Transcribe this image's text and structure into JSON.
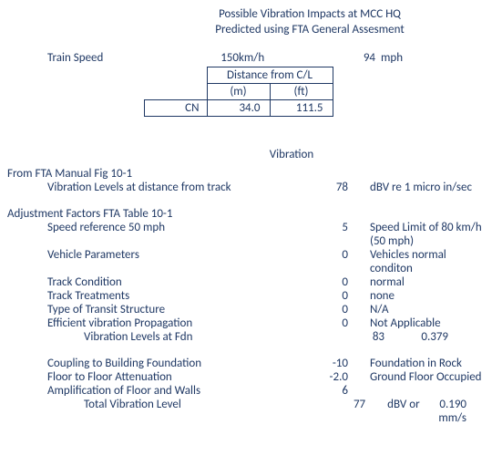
{
  "title": {
    "line1": "Possible Vibration Impacts at MCC HQ",
    "line2": "Predicted using FTA General Assesment"
  },
  "train_speed": {
    "label": "Train Speed",
    "value_kmh": "150",
    "unit_kmh": "km/h",
    "value_mph": "94",
    "unit_mph": "mph"
  },
  "dist_table": {
    "header": "Distance from C/L",
    "col_m": "(m)",
    "col_ft": "(ft)",
    "row_label": "CN",
    "val_m": "34.0",
    "val_ft": "111.5"
  },
  "vibration_heading": "Vibration",
  "from_manual": "From FTA Manual Fig 10-1",
  "levels_at_track": {
    "label": "Vibration Levels at distance from track",
    "value": "78",
    "unit": "dBV re 1 micro in/sec"
  },
  "adj_heading": "Adjustment Factors FTA Table 10-1",
  "factors": {
    "speed_ref": {
      "label": "Speed reference 50 mph",
      "value": "5",
      "note": "Speed Limit of 80 km/h (50 mph)"
    },
    "vehicle": {
      "label": "Vehicle Parameters",
      "value": "0",
      "note": "Vehicles normal conditon"
    },
    "track_cond": {
      "label": "Track Condition",
      "value": "0",
      "note": "normal"
    },
    "track_treat": {
      "label": "Track Treatments",
      "value": "0",
      "note": "none"
    },
    "transit": {
      "label": "Type of Transit Structure",
      "value": "0",
      "note": "N/A"
    },
    "propagation": {
      "label": "Efficient vibration Propagation",
      "value": "0",
      "note": "Not Applicable"
    }
  },
  "levels_at_fdn": {
    "label": "Vibration Levels at Fdn",
    "value": "83",
    "extra": "0.379"
  },
  "building": {
    "coupling": {
      "label": "Coupling to Building Foundation",
      "value": "-10",
      "note": "Foundation in Rock"
    },
    "attenuation": {
      "label": "Floor to Floor Attenuation",
      "value": "-2.0",
      "note": "Ground Floor Occupied"
    },
    "amplification": {
      "label": "Amplification of Floor and Walls",
      "value": "6",
      "note": ""
    }
  },
  "total": {
    "label": "Total Vibration Level",
    "value": "77",
    "unit": "dBV or",
    "extra": "0.190 mm/s"
  }
}
